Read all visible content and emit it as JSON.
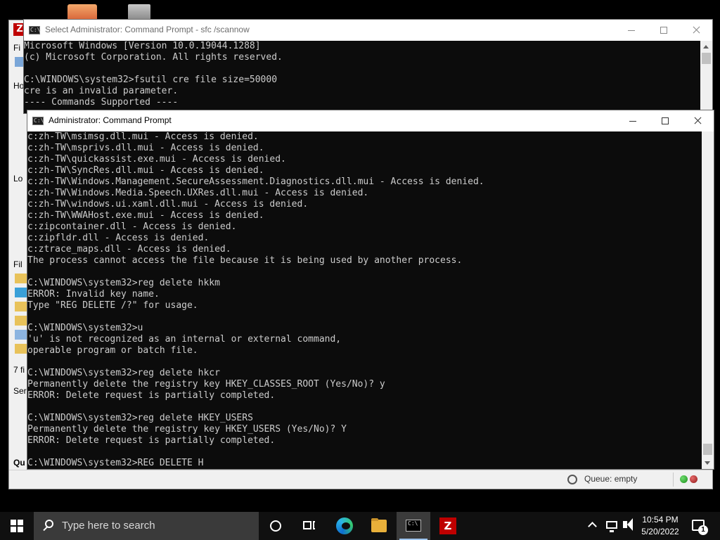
{
  "desktop": {
    "icons": [
      "folder-icon",
      "server-icon"
    ]
  },
  "filezilla": {
    "left_fragments": [
      "Fi",
      "Ho",
      "Lo",
      "Fil",
      "7 fi",
      "Ser",
      "Qu"
    ],
    "status": {
      "queue_label": "Queue: empty"
    }
  },
  "window_back": {
    "title": "Select Administrator: Command Prompt - sfc  /scannow",
    "lines": [
      "Microsoft Windows [Version 10.0.19044.1288]",
      "(c) Microsoft Corporation. All rights reserved.",
      "",
      "C:\\WINDOWS\\system32>fsutil cre file size=50000",
      "cre is an invalid parameter.",
      "---- Commands Supported ----"
    ]
  },
  "window_front": {
    "title": "Administrator: Command Prompt",
    "lines": [
      "c:zh-TW\\msimsg.dll.mui - Access is denied.",
      "c:zh-TW\\msprivs.dll.mui - Access is denied.",
      "c:zh-TW\\quickassist.exe.mui - Access is denied.",
      "c:zh-TW\\SyncRes.dll.mui - Access is denied.",
      "c:zh-TW\\Windows.Management.SecureAssessment.Diagnostics.dll.mui - Access is denied.",
      "c:zh-TW\\Windows.Media.Speech.UXRes.dll.mui - Access is denied.",
      "c:zh-TW\\windows.ui.xaml.dll.mui - Access is denied.",
      "c:zh-TW\\WWAHost.exe.mui - Access is denied.",
      "c:zipcontainer.dll - Access is denied.",
      "c:zipfldr.dll - Access is denied.",
      "c:ztrace_maps.dll - Access is denied.",
      "The process cannot access the file because it is being used by another process.",
      "",
      "C:\\WINDOWS\\system32>reg delete hkkm",
      "ERROR: Invalid key name.",
      "Type \"REG DELETE /?\" for usage.",
      "",
      "C:\\WINDOWS\\system32>u",
      "'u' is not recognized as an internal or external command,",
      "operable program or batch file.",
      "",
      "C:\\WINDOWS\\system32>reg delete hkcr",
      "Permanently delete the registry key HKEY_CLASSES_ROOT (Yes/No)? y",
      "ERROR: Delete request is partially completed.",
      "",
      "C:\\WINDOWS\\system32>reg delete HKEY_USERS",
      "Permanently delete the registry key HKEY_USERS (Yes/No)? Y",
      "ERROR: Delete request is partially completed.",
      "",
      "C:\\WINDOWS\\system32>REG DELETE H"
    ]
  },
  "taskbar": {
    "search_placeholder": "Type here to search",
    "apps": [
      "cortana-icon",
      "task-view-icon",
      "edge-icon",
      "file-explorer-icon",
      "command-prompt-icon",
      "filezilla-icon"
    ],
    "clock": {
      "time": "10:54 PM",
      "date": "5/20/2022"
    },
    "notification_count": "1"
  },
  "colors": {
    "console_bg": "#0c0c0c",
    "console_fg": "#cccccc",
    "taskbar_bg": "#101010",
    "filezilla_red": "#bf0000"
  }
}
